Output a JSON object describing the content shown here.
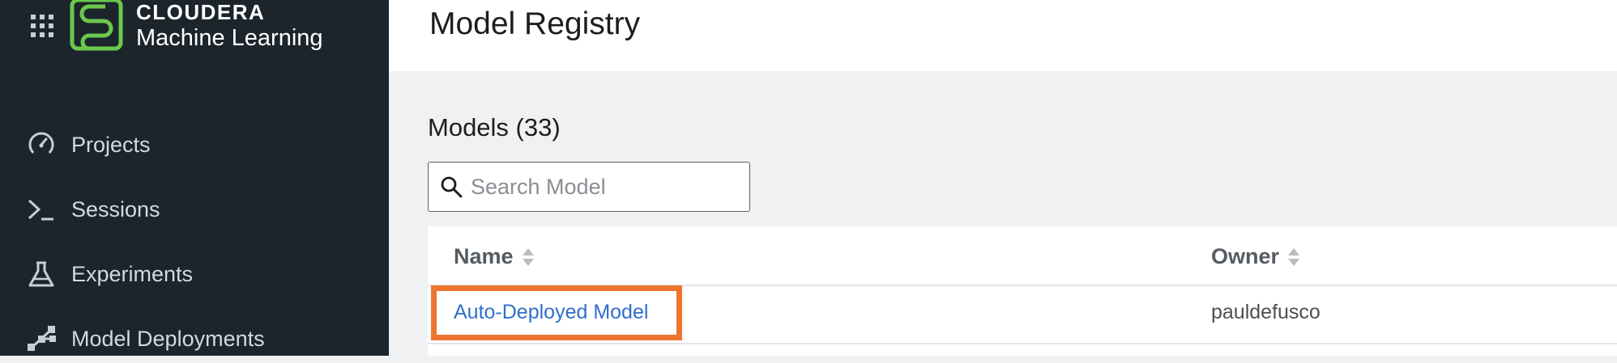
{
  "brand": {
    "name": "CLOUDERA",
    "product": "Machine Learning",
    "accent_color": "#6bc84c"
  },
  "sidebar": {
    "items": [
      {
        "label": "Projects",
        "icon": "gauge-icon"
      },
      {
        "label": "Sessions",
        "icon": "terminal-prompt-icon"
      },
      {
        "label": "Experiments",
        "icon": "flask-icon"
      },
      {
        "label": "Model Deployments",
        "icon": "network-nodes-icon"
      }
    ]
  },
  "header": {
    "title": "Model Registry"
  },
  "models": {
    "title": "Models (33)",
    "search": {
      "placeholder": "Search Model",
      "value": ""
    },
    "table": {
      "columns": [
        "Name",
        "Owner"
      ],
      "rows": [
        {
          "name": "Auto-Deployed Model",
          "owner": "pauldefusco"
        }
      ]
    },
    "highlight_color": "#ee7530"
  }
}
